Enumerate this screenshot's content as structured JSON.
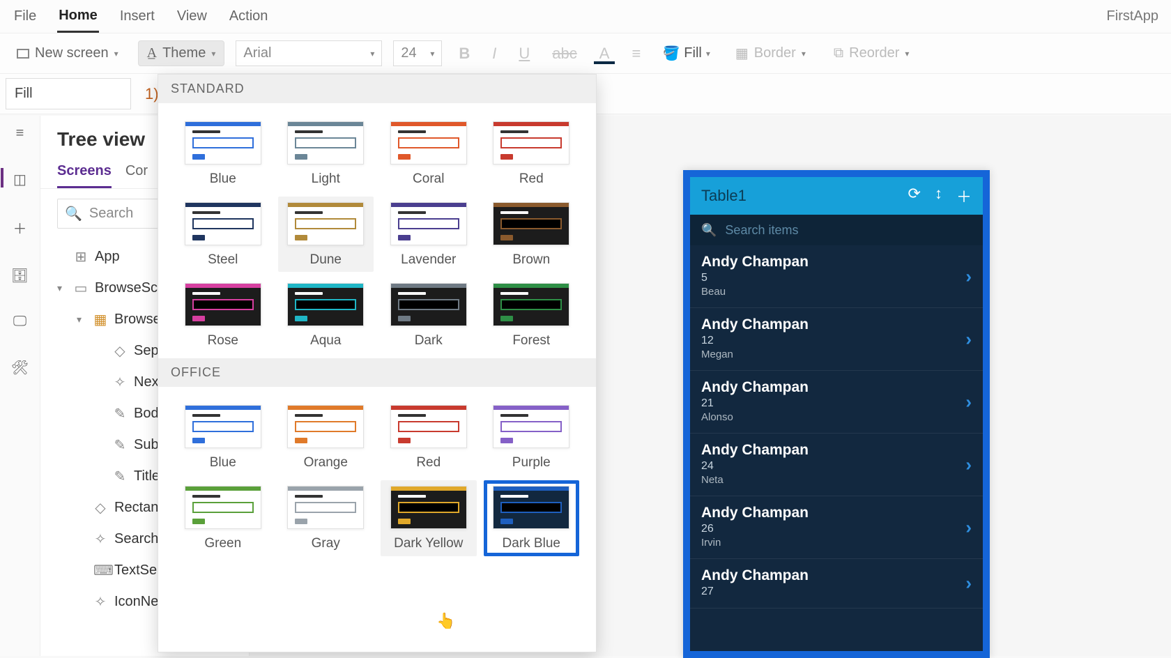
{
  "app_name": "FirstApp",
  "menu": {
    "items": [
      "File",
      "Home",
      "Insert",
      "View",
      "Action"
    ],
    "active_index": 1
  },
  "ribbon": {
    "new_screen": "New screen",
    "theme": "Theme",
    "font": "Arial",
    "font_size": "24",
    "fill": "Fill",
    "border": "Border",
    "reorder": "Reorder"
  },
  "formula": {
    "property": "Fill",
    "value_suffix": "1)"
  },
  "tree": {
    "title": "Tree view",
    "tabs": {
      "screens": "Screens",
      "components": "Cor"
    },
    "search_placeholder": "Search",
    "items": [
      {
        "label": "App",
        "icon": "⊞",
        "level": 0,
        "caret": false
      },
      {
        "label": "BrowseScree",
        "icon": "▭",
        "level": 0,
        "caret": true
      },
      {
        "label": "Browse",
        "icon": "▦",
        "level": 1,
        "caret": true,
        "colored": true
      },
      {
        "label": "Sep",
        "icon": "◇",
        "level": 2
      },
      {
        "label": "Nex",
        "icon": "✧",
        "level": 2
      },
      {
        "label": "Bod",
        "icon": "✎",
        "level": 2
      },
      {
        "label": "Sub",
        "icon": "✎",
        "level": 2
      },
      {
        "label": "Title",
        "icon": "✎",
        "level": 2
      },
      {
        "label": "Rectang",
        "icon": "◇",
        "level": 1
      },
      {
        "label": "SearchIc",
        "icon": "✧",
        "level": 1
      },
      {
        "label": "TextSea",
        "icon": "⌨",
        "level": 1
      },
      {
        "label": "IconNewItem",
        "icon": "✧",
        "level": 1
      }
    ]
  },
  "theme_panel": {
    "sections": [
      {
        "title": "STANDARD",
        "themes": [
          {
            "name": "Blue",
            "primary": "#2f6fdb",
            "dark": false
          },
          {
            "name": "Light",
            "primary": "#6b8697",
            "dark": false
          },
          {
            "name": "Coral",
            "primary": "#e0582a",
            "dark": false
          },
          {
            "name": "Red",
            "primary": "#c83a2e",
            "dark": false
          },
          {
            "name": "Steel",
            "primary": "#1f355f",
            "dark": false
          },
          {
            "name": "Dune",
            "primary": "#b18a3a",
            "dark": false,
            "hover": true
          },
          {
            "name": "Lavender",
            "primary": "#4a3e8f",
            "dark": false
          },
          {
            "name": "Brown",
            "primary": "#8a5a2d",
            "dark": true
          },
          {
            "name": "Rose",
            "primary": "#d63fa0",
            "dark": true
          },
          {
            "name": "Aqua",
            "primary": "#1fb6c6",
            "dark": true
          },
          {
            "name": "Dark",
            "primary": "#6f7a84",
            "dark": true
          },
          {
            "name": "Forest",
            "primary": "#2e8f46",
            "dark": true
          }
        ]
      },
      {
        "title": "OFFICE",
        "themes": [
          {
            "name": "Blue",
            "primary": "#2f6fdb",
            "dark": false
          },
          {
            "name": "Orange",
            "primary": "#e07a2a",
            "dark": false
          },
          {
            "name": "Red",
            "primary": "#c83a2e",
            "dark": false
          },
          {
            "name": "Purple",
            "primary": "#8560c7",
            "dark": false
          },
          {
            "name": "Green",
            "primary": "#5aa03a",
            "dark": false
          },
          {
            "name": "Gray",
            "primary": "#9aa3ab",
            "dark": false
          },
          {
            "name": "Dark Yellow",
            "primary": "#e0a82a",
            "dark": true,
            "hover": true
          },
          {
            "name": "Dark Blue",
            "primary": "#1e5fbf",
            "dark": true,
            "bg": "#12283f",
            "selected": true
          }
        ]
      }
    ]
  },
  "preview": {
    "title": "Table1",
    "search_placeholder": "Search items",
    "items": [
      {
        "title": "Andy Champan",
        "sub1": "5",
        "sub2": "Beau"
      },
      {
        "title": "Andy Champan",
        "sub1": "12",
        "sub2": "Megan"
      },
      {
        "title": "Andy Champan",
        "sub1": "21",
        "sub2": "Alonso"
      },
      {
        "title": "Andy Champan",
        "sub1": "24",
        "sub2": "Neta"
      },
      {
        "title": "Andy Champan",
        "sub1": "26",
        "sub2": "Irvin"
      },
      {
        "title": "Andy Champan",
        "sub1": "27",
        "sub2": ""
      }
    ]
  }
}
